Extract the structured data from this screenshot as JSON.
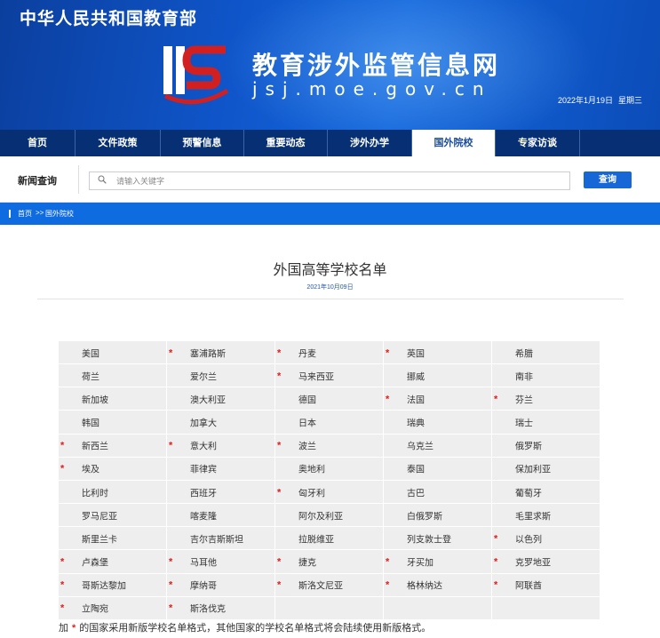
{
  "banner": {
    "ministry": "中华人民共和国教育部",
    "site_title": "教育涉外监管信息网",
    "domain": "jsj.moe.gov.cn",
    "date": "2022年1月19日",
    "weekday": "星期三"
  },
  "nav": {
    "items": [
      {
        "label": "首页",
        "active": false
      },
      {
        "label": "文件政策",
        "active": false
      },
      {
        "label": "预警信息",
        "active": false
      },
      {
        "label": "重要动态",
        "active": false
      },
      {
        "label": "涉外办学",
        "active": false
      },
      {
        "label": "国外院校",
        "active": true
      },
      {
        "label": "专家访谈",
        "active": false
      }
    ]
  },
  "search": {
    "label": "新闻查询",
    "placeholder": "请输入关键字",
    "button_label": "查询",
    "icon": "search-icon"
  },
  "breadcrumb": {
    "home": "首页",
    "separator": ">>",
    "current": "国外院校"
  },
  "article": {
    "title": "外国高等学校名单",
    "date": "2021年10月09日"
  },
  "countries": [
    {
      "name": "美国",
      "new_format": false
    },
    {
      "name": "塞浦路斯",
      "new_format": true
    },
    {
      "name": "丹麦",
      "new_format": true
    },
    {
      "name": "英国",
      "new_format": true
    },
    {
      "name": "希腊",
      "new_format": false
    },
    {
      "name": "荷兰",
      "new_format": false
    },
    {
      "name": "爱尔兰",
      "new_format": false
    },
    {
      "name": "马来西亚",
      "new_format": true
    },
    {
      "name": "挪威",
      "new_format": false
    },
    {
      "name": "南非",
      "new_format": false
    },
    {
      "name": "新加坡",
      "new_format": false
    },
    {
      "name": "澳大利亚",
      "new_format": false
    },
    {
      "name": "德国",
      "new_format": false
    },
    {
      "name": "法国",
      "new_format": true
    },
    {
      "name": "芬兰",
      "new_format": true
    },
    {
      "name": "韩国",
      "new_format": false
    },
    {
      "name": "加拿大",
      "new_format": false
    },
    {
      "name": "日本",
      "new_format": false
    },
    {
      "name": "瑞典",
      "new_format": false
    },
    {
      "name": "瑞士",
      "new_format": false
    },
    {
      "name": "新西兰",
      "new_format": true
    },
    {
      "name": "意大利",
      "new_format": true
    },
    {
      "name": "波兰",
      "new_format": true
    },
    {
      "name": "乌克兰",
      "new_format": false
    },
    {
      "name": "俄罗斯",
      "new_format": false
    },
    {
      "name": "埃及",
      "new_format": true
    },
    {
      "name": "菲律宾",
      "new_format": false
    },
    {
      "name": "奥地利",
      "new_format": false
    },
    {
      "name": "泰国",
      "new_format": false
    },
    {
      "name": "保加利亚",
      "new_format": false
    },
    {
      "name": "比利时",
      "new_format": false
    },
    {
      "name": "西班牙",
      "new_format": false
    },
    {
      "name": "匈牙利",
      "new_format": true
    },
    {
      "name": "古巴",
      "new_format": false
    },
    {
      "name": "葡萄牙",
      "new_format": false
    },
    {
      "name": "罗马尼亚",
      "new_format": false
    },
    {
      "name": "喀麦隆",
      "new_format": false
    },
    {
      "name": "阿尔及利亚",
      "new_format": false
    },
    {
      "name": "白俄罗斯",
      "new_format": false
    },
    {
      "name": "毛里求斯",
      "new_format": false
    },
    {
      "name": "斯里兰卡",
      "new_format": false
    },
    {
      "name": "吉尔吉斯斯坦",
      "new_format": false
    },
    {
      "name": "拉脱维亚",
      "new_format": false
    },
    {
      "name": "列支敦士登",
      "new_format": false
    },
    {
      "name": "以色列",
      "new_format": true
    },
    {
      "name": "卢森堡",
      "new_format": true
    },
    {
      "name": "马耳他",
      "new_format": true
    },
    {
      "name": "捷克",
      "new_format": true
    },
    {
      "name": "牙买加",
      "new_format": true
    },
    {
      "name": "克罗地亚",
      "new_format": true
    },
    {
      "name": "哥斯达黎加",
      "new_format": true
    },
    {
      "name": "摩纳哥",
      "new_format": true
    },
    {
      "name": "斯洛文尼亚",
      "new_format": true
    },
    {
      "name": "格林纳达",
      "new_format": true
    },
    {
      "name": "阿联酋",
      "new_format": true
    },
    {
      "name": "立陶宛",
      "new_format": true
    },
    {
      "name": "斯洛伐克",
      "new_format": true
    }
  ],
  "marker": "*",
  "footnote": {
    "prefix": "加",
    "marker": "*",
    "text": "的国家采用新版学校名单格式，其他国家的学校名单格式将会陆续使用新版格式。"
  },
  "colors": {
    "banner": "#0f55c9",
    "nav": "#062f74",
    "accent": "#1767d6",
    "marker": "#e02020"
  }
}
